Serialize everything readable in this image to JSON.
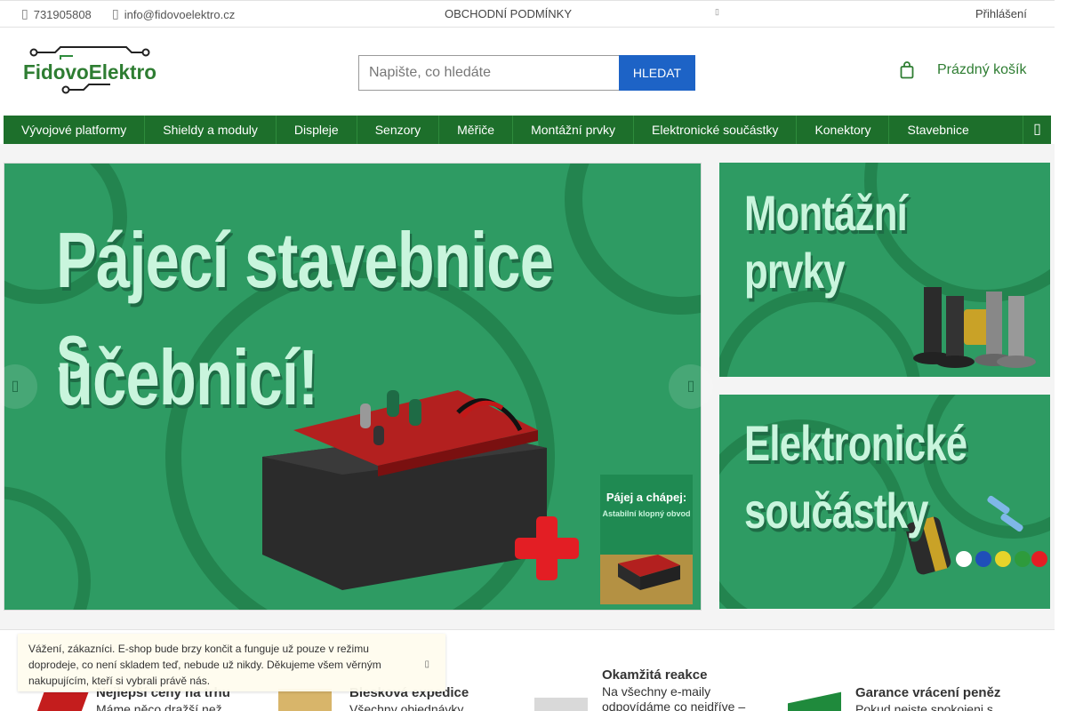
{
  "topbar": {
    "phone": "731905808",
    "email": "info@fidovoelektro.cz",
    "terms": "OBCHODNÍ PODMÍNKY",
    "login": "Přihlášení"
  },
  "header": {
    "logo_text": "FidovoElektro",
    "search": {
      "placeholder": "Napište, co hledáte",
      "value": "",
      "button": "HLEDAT"
    },
    "cart_label": "Prázdný košík"
  },
  "nav": {
    "items": [
      "Vývojové platformy",
      "Shieldy a moduly",
      "Displeje",
      "Senzory",
      "Měřiče",
      "Montážní prvky",
      "Elektronické součástky",
      "Konektory",
      "Stavebnice"
    ]
  },
  "banners": {
    "main_line1": "Pájecí stavebnice s",
    "main_line2": "učebnicí!",
    "book_title": "Pájej a chápej:",
    "book_subtitle": "Astabilní klopný obvod",
    "side1": "Montážní prvky",
    "side2_line1": "Elektronické",
    "side2_line2": "součástky"
  },
  "benefits": [
    {
      "title": "Nejlepší ceny na trhu",
      "desc": "Máme něco dražší než"
    },
    {
      "title": "Blesková expedice",
      "desc": "Všechny objednávky"
    },
    {
      "title": "Okamžitá reakce",
      "desc": "Na všechny e-maily",
      "desc2": "odpovídáme co nejdříve –"
    },
    {
      "title": "Garance vrácení peněz",
      "desc": "Pokud nejste spokojeni s"
    }
  ],
  "notice": {
    "text": "Vážení, zákazníci. E-shop bude brzy končit a funguje už pouze v režimu doprodeje, co není skladem teď, nebude už nikdy. Děkujeme všem věrným nakupujícím, kteří si vybrali právě nás."
  },
  "colors": {
    "nav_green": "#1d6f2b",
    "search_button_blue": "#1d63c6",
    "banner_green": "#2e9b63",
    "banner_text": "#c9f5dd"
  }
}
